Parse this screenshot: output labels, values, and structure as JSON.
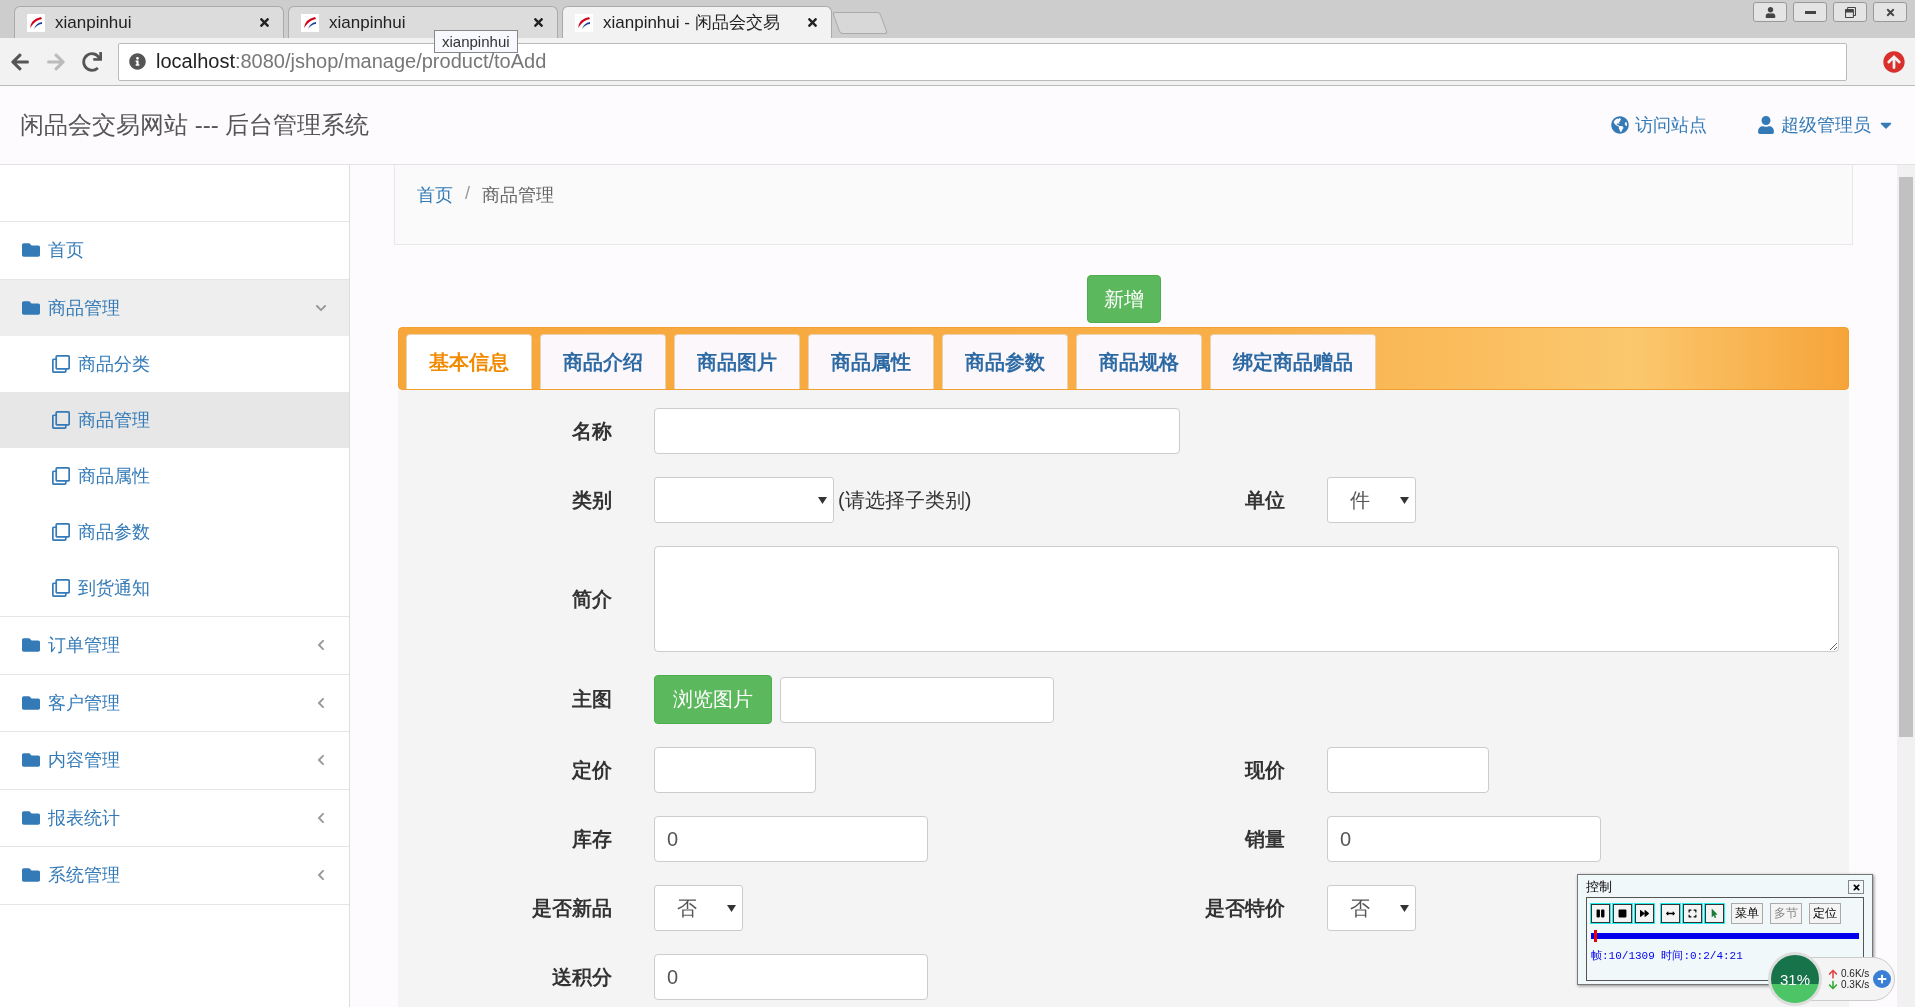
{
  "browser": {
    "tabs": [
      {
        "title": "xianpinhui",
        "selected": false
      },
      {
        "title": "xianpinhui",
        "selected": false
      },
      {
        "title": "xianpinhui - 闲品会交易",
        "selected": true
      }
    ],
    "tooltip": "xianpinhui",
    "address": {
      "host": "localhost",
      "path": ":8080/jshop/manage/product/toAdd"
    }
  },
  "header": {
    "title": "闲品会交易网站 --- 后台管理系统",
    "links": [
      {
        "label": "访问站点",
        "kind": "globe",
        "dropdown": false
      },
      {
        "label": "超级管理员",
        "kind": "user",
        "dropdown": true
      }
    ]
  },
  "sidebar": {
    "items": [
      {
        "label": "首页",
        "kind": "link"
      },
      {
        "label": "商品管理",
        "kind": "group",
        "expanded": true,
        "children": [
          {
            "label": "商品分类",
            "selected": false
          },
          {
            "label": "商品管理",
            "selected": true
          },
          {
            "label": "商品属性",
            "selected": false
          },
          {
            "label": "商品参数",
            "selected": false
          },
          {
            "label": "到货通知",
            "selected": false
          }
        ]
      },
      {
        "label": "订单管理",
        "kind": "group",
        "expanded": false
      },
      {
        "label": "客户管理",
        "kind": "group",
        "expanded": false
      },
      {
        "label": "内容管理",
        "kind": "group",
        "expanded": false
      },
      {
        "label": "报表统计",
        "kind": "group",
        "expanded": false
      },
      {
        "label": "系统管理",
        "kind": "group",
        "expanded": false
      }
    ]
  },
  "breadcrumb": {
    "items": [
      "首页",
      "商品管理"
    ],
    "separator": "/"
  },
  "add_button": "新增",
  "form_tabs": [
    {
      "label": "基本信息",
      "selected": true
    },
    {
      "label": "商品介绍",
      "selected": false
    },
    {
      "label": "商品图片",
      "selected": false
    },
    {
      "label": "商品属性",
      "selected": false
    },
    {
      "label": "商品参数",
      "selected": false
    },
    {
      "label": "商品规格",
      "selected": false
    },
    {
      "label": "绑定商品赠品",
      "selected": false
    }
  ],
  "form_rows": [
    {
      "fields": [
        {
          "label": "名称",
          "kind": "text"
        }
      ]
    },
    {
      "fields": [
        {
          "label": "类别",
          "kind": "select",
          "hint": "(请选择子类别)"
        },
        {
          "label": "单位",
          "kind": "select",
          "value": "件"
        }
      ]
    },
    {
      "fields": [
        {
          "label": "简介",
          "kind": "textarea"
        }
      ]
    },
    {
      "fields": [
        {
          "label": "主图",
          "kind": "file",
          "button": "浏览图片"
        }
      ]
    },
    {
      "fields": [
        {
          "label": "定价",
          "kind": "text"
        },
        {
          "label": "现价",
          "kind": "text"
        }
      ]
    },
    {
      "fields": [
        {
          "label": "库存",
          "kind": "text",
          "value": "0"
        },
        {
          "label": "销量",
          "kind": "text",
          "value": "0"
        }
      ]
    },
    {
      "fields": [
        {
          "label": "是否新品",
          "kind": "select",
          "value": "否"
        },
        {
          "label": "是否特价",
          "kind": "select",
          "value": "否"
        }
      ]
    },
    {
      "fields": [
        {
          "label": "送积分",
          "kind": "text",
          "value": "0"
        }
      ]
    }
  ],
  "recorder": {
    "title": "控制",
    "buttons": [
      {
        "label": "菜单",
        "disabled": false
      },
      {
        "label": "多节",
        "disabled": true
      },
      {
        "label": "定位",
        "disabled": false
      }
    ],
    "level": 0.01,
    "status": "帧:10/1309 时间:0:2/4:21"
  },
  "net_widget": {
    "percent": "31%",
    "up": "0.6K/s",
    "down": "0.3K/s"
  }
}
